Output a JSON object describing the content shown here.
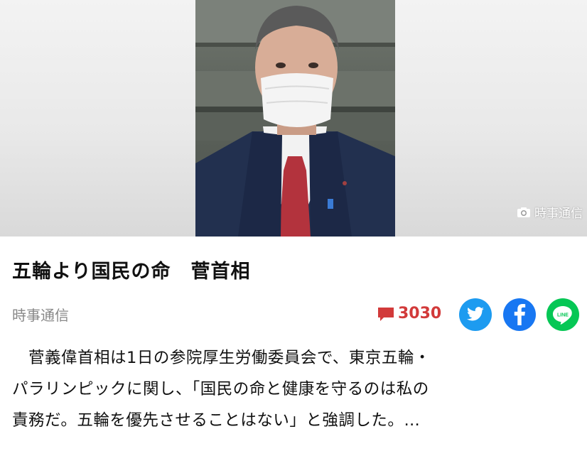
{
  "photo": {
    "credit": "時事通信",
    "alt": "菅首相"
  },
  "article": {
    "headline": "五輪より国民の命　菅首相",
    "source": "時事通信",
    "comment_count": "3030",
    "body_lines": [
      "　菅義偉首相は1日の参院厚生労働委員会で、東京五輪・",
      "パラリンピックに関し、「国民の命と健康を守るのは私の",
      "責務だ。五輪を優先させることはない」と強調した。…"
    ]
  },
  "share": {
    "line_label": "LINE"
  },
  "icons": [
    "camera-icon",
    "comment-icon",
    "twitter-icon",
    "facebook-icon",
    "line-icon"
  ],
  "colors": {
    "comment": "#d23a3a",
    "twitter": "#1d9bf0",
    "facebook": "#1877f2",
    "line": "#06c755"
  }
}
